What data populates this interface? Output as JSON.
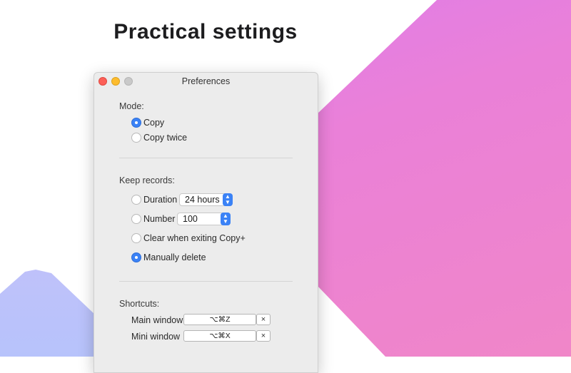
{
  "headline": "Practical settings",
  "window": {
    "title": "Preferences"
  },
  "mode": {
    "label": "Mode:",
    "options": [
      {
        "label": "Copy",
        "selected": true
      },
      {
        "label": "Copy twice",
        "selected": false
      }
    ]
  },
  "records": {
    "label": "Keep records:",
    "duration": {
      "label": "Duration",
      "selected": false,
      "value": "24 hours"
    },
    "number": {
      "label": "Number",
      "selected": false,
      "value": "100"
    },
    "clear_on_exit": {
      "label": "Clear when exiting Copy+",
      "selected": false
    },
    "manual": {
      "label": "Manually delete",
      "selected": true
    }
  },
  "shortcuts": {
    "label": "Shortcuts:",
    "main": {
      "label": "Main window",
      "keys": "⌥⌘Z",
      "clear": "×"
    },
    "mini": {
      "label": "Mini window",
      "keys": "⌥⌘X",
      "clear": "×"
    }
  },
  "colors": {
    "accent": "#3b82f6",
    "headline": "#1d1d1f",
    "gradient_start": "#da7cf0",
    "gradient_end": "#f086c8"
  }
}
